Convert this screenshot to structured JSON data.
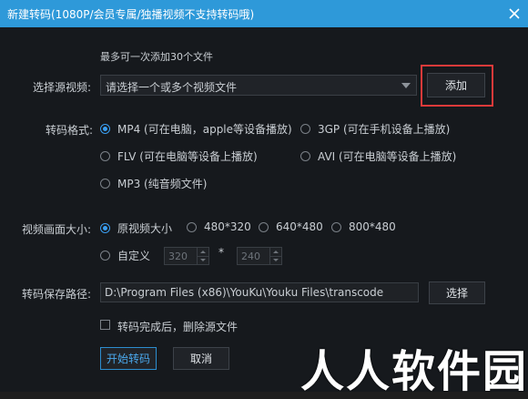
{
  "window": {
    "title": "新建转码(1080P/会员专属/独播视频不支持转码哦)"
  },
  "source": {
    "note": "最多可一次添加30个文件",
    "label": "选择源视频:",
    "placeholder": "请选择一个或多个视频文件",
    "add_button": "添加"
  },
  "format": {
    "label": "转码格式:",
    "options": [
      {
        "label": "MP4 (可在电脑，apple等设备播放)",
        "selected": true
      },
      {
        "label": "3GP  (可在手机设备上播放)",
        "selected": false
      },
      {
        "label": "FLV  (可在电脑等设备上播放)",
        "selected": false
      },
      {
        "label": "AVI  (可在电脑等设备上播放)",
        "selected": false
      },
      {
        "label": "MP3 (纯音频文件)",
        "selected": false
      }
    ]
  },
  "size": {
    "label": "视频画面大小:",
    "options": [
      {
        "label": "原视频大小",
        "selected": true
      },
      {
        "label": "480*320",
        "selected": false
      },
      {
        "label": "640*480",
        "selected": false
      },
      {
        "label": "800*480",
        "selected": false
      },
      {
        "label": "自定义",
        "selected": false
      }
    ],
    "custom_width": "320",
    "separator": "*",
    "custom_height": "240"
  },
  "output": {
    "label": "转码保存路径:",
    "path": "D:\\Program Files (x86)\\YouKu\\Youku Files\\transcode",
    "browse_button": "选择"
  },
  "delete_source": {
    "label": "转码完成后，删除源文件",
    "checked": false
  },
  "actions": {
    "start": "开始转码",
    "cancel": "取消"
  },
  "watermark": "人人软件园"
}
